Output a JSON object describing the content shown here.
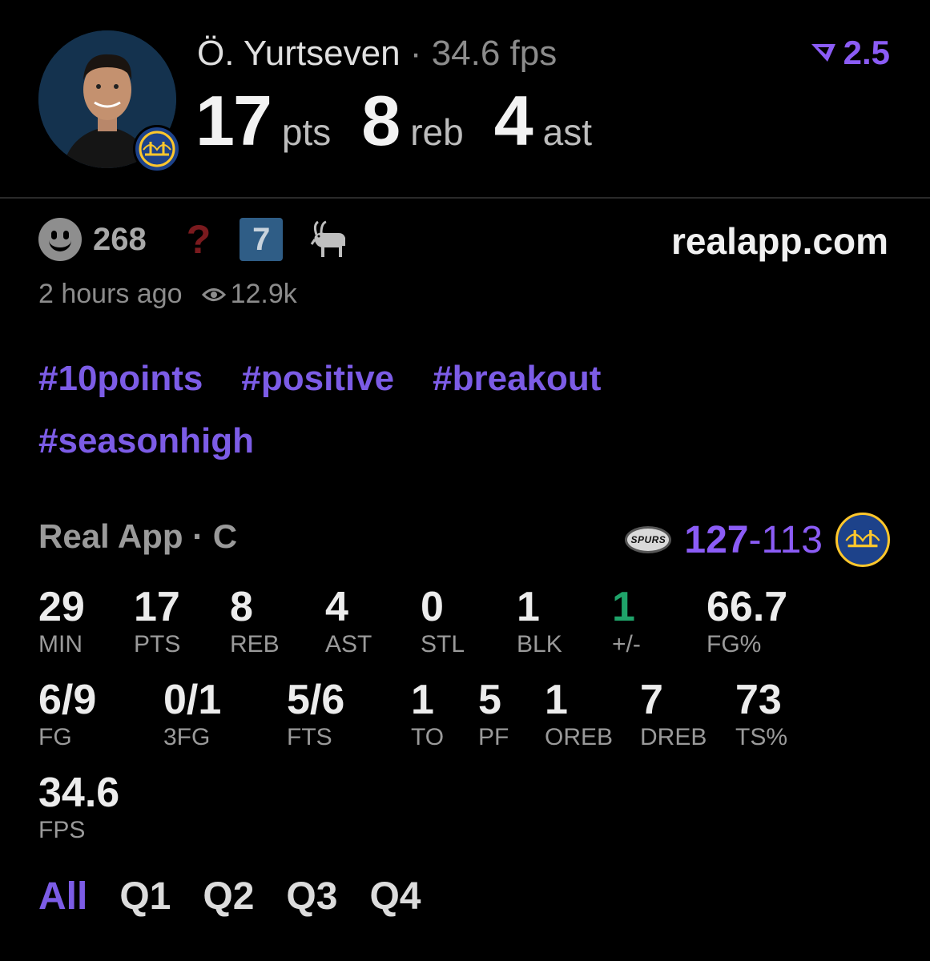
{
  "player": {
    "name": "Ö. Yurtseven",
    "separator": "·",
    "fps_label": "34.6 fps",
    "rating": "2.5",
    "statline": [
      {
        "value": "17",
        "unit": "pts"
      },
      {
        "value": "8",
        "unit": "reb"
      },
      {
        "value": "4",
        "unit": "ast"
      }
    ]
  },
  "reactions": {
    "count": "268",
    "question": "?",
    "badge_number": "7",
    "domain": "realapp.com"
  },
  "meta": {
    "time_ago": "2 hours ago",
    "views": "12.9k"
  },
  "tags": [
    "#10points",
    "#positive",
    "#breakout",
    "#seasonhigh"
  ],
  "game": {
    "label": "Real App · C",
    "opponent_logo_text": "SPURS",
    "score_winner": "127",
    "score_dash": "-",
    "score_loser": "113"
  },
  "stats_row1": [
    {
      "value": "29",
      "label": "MIN"
    },
    {
      "value": "17",
      "label": "PTS"
    },
    {
      "value": "8",
      "label": "REB"
    },
    {
      "value": "4",
      "label": "AST"
    },
    {
      "value": "0",
      "label": "STL"
    },
    {
      "value": "1",
      "label": "BLK"
    },
    {
      "value": "1",
      "label": "+/-"
    },
    {
      "value": "66.7",
      "label": "FG%"
    }
  ],
  "stats_row2": [
    {
      "value": "6/9",
      "label": "FG"
    },
    {
      "value": "0/1",
      "label": "3FG"
    },
    {
      "value": "5/6",
      "label": "FTS"
    },
    {
      "value": "1",
      "label": "TO"
    },
    {
      "value": "5",
      "label": "PF"
    },
    {
      "value": "1",
      "label": "OREB"
    },
    {
      "value": "7",
      "label": "DREB"
    },
    {
      "value": "73",
      "label": "TS%"
    }
  ],
  "stats_row3": [
    {
      "value": "34.6",
      "label": "FPS"
    }
  ],
  "quarters": [
    "All",
    "Q1",
    "Q2",
    "Q3",
    "Q4"
  ],
  "colors": {
    "accent": "#8b5cf6",
    "positive": "#1fa36a",
    "background": "#000000"
  }
}
